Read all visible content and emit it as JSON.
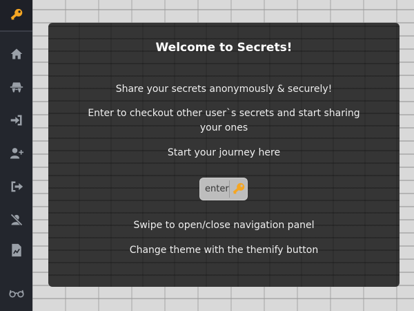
{
  "sidebar": {
    "accent_color": "#f5a623",
    "icon_color": "#9aa0a8",
    "items": [
      {
        "name": "key-logo-icon"
      },
      {
        "name": "home-icon"
      },
      {
        "name": "incognito-icon"
      },
      {
        "name": "sign-in-icon"
      },
      {
        "name": "add-user-icon"
      },
      {
        "name": "sign-out-icon"
      },
      {
        "name": "user-slash-icon"
      },
      {
        "name": "file-chart-icon"
      },
      {
        "name": "glasses-icon"
      }
    ]
  },
  "main": {
    "title": "Welcome to Secrets!",
    "line1": "Share your secrets anonymously & securely!",
    "line2": "Enter to checkout other user`s secrets and start sharing your ones",
    "line3": "Start your journey here",
    "enter_label": "enter",
    "line4": "Swipe to open/close navigation panel",
    "line5": "Change theme with the themify button"
  }
}
